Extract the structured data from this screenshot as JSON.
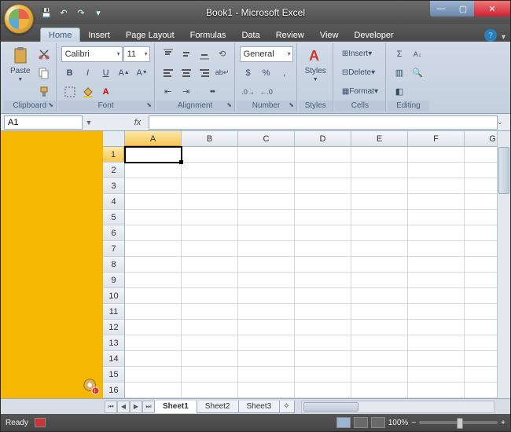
{
  "title": "Book1 - Microsoft Excel",
  "qat": {
    "save": "💾",
    "undo": "↶",
    "redo": "↷"
  },
  "tabs": {
    "home": "Home",
    "insert": "Insert",
    "pagelayout": "Page Layout",
    "formulas": "Formulas",
    "data": "Data",
    "review": "Review",
    "view": "View",
    "developer": "Developer"
  },
  "ribbon": {
    "clipboard": {
      "label": "Clipboard",
      "paste": "Paste"
    },
    "font": {
      "label": "Font",
      "name": "Calibri",
      "size": "11",
      "bold": "B",
      "italic": "I",
      "underline": "U"
    },
    "alignment": {
      "label": "Alignment"
    },
    "number": {
      "label": "Number",
      "format": "General",
      "currency": "$",
      "percent": "%",
      "comma": ","
    },
    "styles": {
      "label": "Styles",
      "btn": "Styles"
    },
    "cells": {
      "label": "Cells",
      "insert": "Insert",
      "delete": "Delete",
      "format": "Format"
    },
    "editing": {
      "label": "Editing",
      "sum": "Σ"
    }
  },
  "namebox": "A1",
  "fx": "fx",
  "columns": [
    "A",
    "B",
    "C",
    "D",
    "E",
    "F",
    "G"
  ],
  "rows": [
    "1",
    "2",
    "3",
    "4",
    "5",
    "6",
    "7",
    "8",
    "9",
    "10",
    "11",
    "12",
    "13",
    "14",
    "15",
    "16"
  ],
  "active_cell": "A1",
  "sheets": {
    "s1": "Sheet1",
    "s2": "Sheet2",
    "s3": "Sheet3"
  },
  "status": {
    "ready": "Ready",
    "zoom": "100%",
    "minus": "−",
    "plus": "+"
  },
  "help": "?"
}
